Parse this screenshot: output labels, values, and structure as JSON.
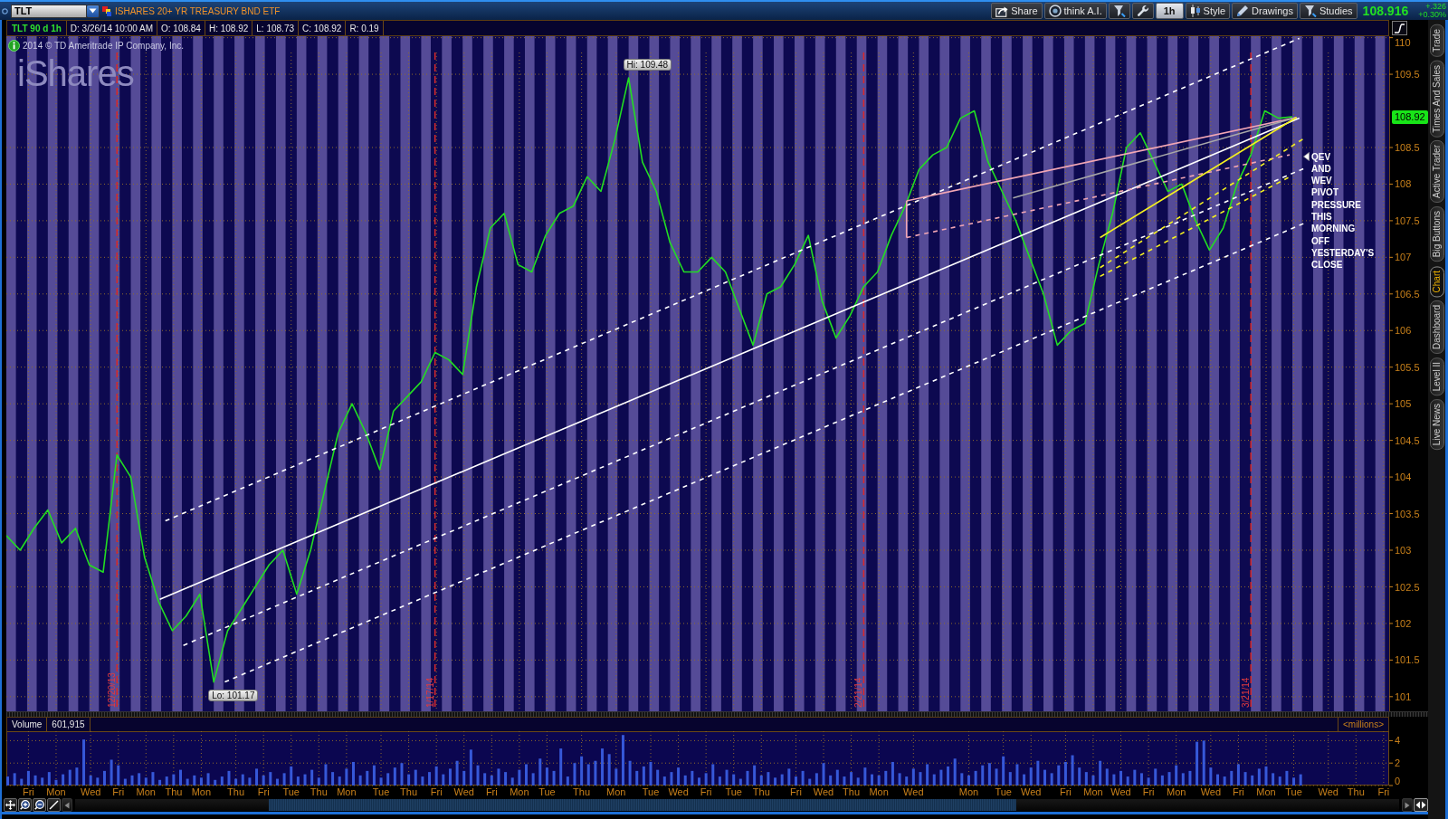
{
  "toolbar": {
    "symbol": "TLT",
    "description": "ISHARES 20+ YR TREASURY BND ETF",
    "buttons": [
      {
        "kind": "share",
        "label": "Share"
      },
      {
        "kind": "assistant",
        "label": "think A.I."
      },
      {
        "kind": "tools"
      },
      {
        "kind": "wrench"
      },
      {
        "kind": "interval",
        "label": "1h"
      },
      {
        "kind": "style",
        "label": "Style"
      },
      {
        "kind": "drawings",
        "label": "Drawings"
      },
      {
        "kind": "studies",
        "label": "Studies"
      }
    ],
    "last_price": "108.916",
    "change": "+.326",
    "change_percent": "+0.30%"
  },
  "info_bar": {
    "study": "TLT 90 d 1h",
    "fields": [
      "D: 3/26/14 10:00 AM",
      "O: 108.84",
      "H: 108.92",
      "L: 108.73",
      "C: 108.92",
      "R: 0.19"
    ]
  },
  "price_chart": {
    "copyright": "2014 © TD Ameritrade IP Company, Inc.",
    "logo_text": "iShares",
    "high_label": "Hi: 109.48",
    "low_label": "Lo: 101.17",
    "current_price": "108.92",
    "note": "QEV AND WEV PIVOT PRESSURE THIS MORNING OFF YESTERDAY'S CLOSE",
    "chart_data": {
      "type": "line",
      "categories": [
        null,
        null,
        null,
        null,
        null,
        null,
        null,
        null,
        "12/20/13",
        null,
        null,
        null,
        null,
        null,
        null,
        null,
        null,
        null,
        null,
        null,
        null,
        null,
        null,
        null,
        null,
        null,
        null,
        null,
        null,
        null,
        null,
        "1/17/14",
        null,
        null,
        null,
        null,
        null,
        null,
        null,
        null,
        null,
        null,
        null,
        null,
        null,
        null,
        null,
        null,
        null,
        null,
        null,
        null,
        null,
        null,
        null,
        null,
        null,
        null,
        null,
        null,
        null,
        null,
        "2/21/14",
        null,
        null,
        null,
        null,
        null,
        null,
        null,
        null,
        null,
        null,
        null,
        null,
        null,
        null,
        null,
        null,
        null,
        null,
        null,
        null,
        null,
        null,
        null,
        null,
        null,
        null,
        null,
        "3/21/14",
        null,
        null,
        null,
        null,
        null,
        null,
        null,
        null,
        null
      ],
      "series": [
        {
          "color": "#22dd22",
          "values": [
            103.2,
            103.0,
            103.3,
            103.55,
            103.1,
            103.3,
            102.8,
            102.7,
            104.3,
            104.0,
            102.9,
            102.3,
            101.9,
            102.1,
            102.4,
            101.2,
            101.9,
            102.2,
            102.5,
            102.8,
            103.0,
            102.4,
            103.0,
            103.8,
            104.6,
            105.0,
            104.6,
            104.1,
            104.9,
            105.1,
            105.3,
            105.7,
            105.6,
            105.4,
            106.6,
            107.4,
            107.6,
            106.9,
            106.8,
            107.3,
            107.6,
            107.7,
            108.1,
            107.9,
            108.6,
            109.45,
            108.3,
            107.9,
            107.2,
            106.8,
            106.8,
            107.0,
            106.8,
            106.3,
            105.8,
            106.5,
            106.6,
            106.9,
            107.3,
            106.4,
            105.9,
            106.2,
            106.6,
            106.8,
            107.3,
            107.7,
            108.2,
            108.4,
            108.5,
            108.9,
            109.0,
            108.3,
            107.9,
            107.5,
            107.0,
            106.5,
            105.8,
            106.0,
            106.1,
            106.9,
            107.6,
            108.5,
            108.7,
            108.3,
            107.9,
            108.0,
            107.5,
            107.1,
            107.4,
            108.0,
            108.4,
            109.0,
            108.9,
            108.92,
            null,
            null,
            null,
            null,
            null,
            null
          ]
        }
      ],
      "ylim": [
        100.8,
        110.02
      ],
      "yticks": [
        101,
        101.5,
        102,
        102.5,
        103,
        103.5,
        104,
        104.5,
        105,
        105.5,
        106,
        106.5,
        107,
        107.5,
        108,
        108.5,
        109.5,
        110
      ],
      "grid": true
    }
  },
  "volume_chart": {
    "title": "Volume",
    "reading": "601,915",
    "units": "<millions>",
    "chart_data": {
      "type": "bar",
      "categories": [
        null,
        null,
        null,
        "Fri",
        null,
        null,
        null,
        "Mon",
        null,
        null,
        null,
        null,
        "Wed",
        null,
        null,
        null,
        "Fri",
        null,
        null,
        null,
        "Mon",
        null,
        null,
        null,
        "Thu",
        null,
        null,
        null,
        "Mon",
        null,
        null,
        null,
        null,
        "Thu",
        null,
        null,
        null,
        "Fri",
        null,
        null,
        null,
        "Tue",
        null,
        null,
        null,
        "Thu",
        null,
        null,
        null,
        "Mon",
        null,
        null,
        null,
        null,
        "Tue",
        null,
        null,
        null,
        "Thu",
        null,
        null,
        null,
        "Fri",
        null,
        null,
        null,
        "Wed",
        null,
        null,
        null,
        "Fri",
        null,
        null,
        null,
        "Mon",
        null,
        null,
        null,
        "Tue",
        null,
        null,
        null,
        null,
        "Thu",
        null,
        null,
        null,
        null,
        "Mon",
        null,
        null,
        null,
        null,
        "Tue",
        null,
        null,
        null,
        "Wed",
        null,
        null,
        null,
        "Fri",
        null,
        null,
        null,
        "Tue",
        null,
        null,
        null,
        "Thu",
        null,
        null,
        null,
        null,
        "Fri",
        null,
        null,
        null,
        "Wed",
        null,
        null,
        null,
        "Thu",
        null,
        null,
        null,
        "Mon",
        null,
        null,
        null,
        null,
        "Wed",
        null,
        null,
        null,
        null,
        null,
        null,
        null,
        "Mon",
        null,
        null,
        null,
        null,
        "Tue",
        null,
        null,
        null,
        "Wed",
        null,
        null,
        null,
        null,
        "Fri",
        null,
        null,
        null,
        "Mon",
        null,
        null,
        null,
        "Wed",
        null,
        null,
        null,
        "Fri",
        null,
        null,
        null,
        "Mon",
        null,
        null,
        null,
        null,
        "Wed",
        null,
        null,
        null,
        "Fri",
        null,
        null,
        null,
        "Mon",
        null,
        null,
        null,
        "Tue",
        null,
        null,
        null,
        null,
        "Wed",
        null,
        null,
        null,
        "Thu",
        null,
        null,
        null,
        "Fri"
      ],
      "series": [
        {
          "color": "#3658d8",
          "values": [
            0.8,
            1.1,
            0.6,
            1.3,
            0.9,
            0.7,
            1.2,
            0.5,
            1.0,
            1.4,
            1.6,
            4.1,
            0.9,
            0.7,
            1.3,
            2.3,
            1.8,
            0.6,
            0.9,
            1.1,
            0.7,
            1.2,
            0.5,
            0.8,
            1.0,
            1.4,
            0.6,
            0.9,
            0.7,
            1.1,
            0.5,
            0.8,
            1.3,
            0.6,
            1.0,
            0.7,
            1.5,
            0.9,
            1.2,
            0.6,
            1.1,
            1.7,
            0.8,
            1.0,
            1.4,
            0.7,
            1.9,
            1.2,
            0.8,
            1.5,
            2.1,
            0.9,
            1.3,
            1.8,
            0.7,
            1.1,
            1.6,
            2.0,
            1.0,
            1.4,
            0.8,
            1.2,
            1.7,
            1.0,
            1.5,
            2.2,
            1.3,
            3.2,
            1.8,
            1.1,
            0.9,
            1.5,
            1.2,
            0.7,
            1.4,
            1.9,
            1.1,
            2.4,
            1.6,
            1.3,
            3.3,
            0.8,
            2.0,
            2.6,
            1.9,
            2.2,
            3.3,
            2.8,
            1.5,
            4.5,
            2.2,
            1.3,
            1.7,
            2.1,
            1.4,
            0.8,
            1.2,
            1.6,
            0.9,
            1.3,
            0.7,
            1.1,
            1.9,
            0.8,
            1.4,
            1.0,
            0.6,
            1.3,
            1.8,
            0.9,
            1.2,
            0.7,
            1.0,
            1.5,
            0.8,
            1.3,
            0.6,
            1.1,
            2.0,
            0.9,
            1.4,
            0.8,
            1.2,
            0.7,
            1.6,
            1.0,
            0.9,
            1.3,
            2.1,
            1.1,
            0.8,
            1.5,
            1.2,
            1.9,
            1.0,
            1.4,
            1.7,
            2.4,
            1.1,
            0.9,
            1.3,
            1.8,
            2.0,
            1.5,
            2.6,
            1.2,
            1.9,
            1.0,
            1.6,
            2.2,
            1.4,
            1.1,
            1.8,
            2.1,
            2.7,
            1.6,
            1.2,
            0.9,
            2.2,
            1.5,
            1.0,
            1.3,
            0.8,
            1.4,
            1.1,
            0.7,
            1.5,
            0.9,
            1.2,
            1.8,
            1.1,
            1.3,
            3.9,
            4.0,
            1.6,
            1.0,
            0.8,
            1.3,
            1.9,
            1.2,
            0.9,
            1.5,
            1.7,
            1.1,
            0.8,
            1.3,
            0.7,
            1.0,
            null,
            null,
            null,
            null,
            null,
            null,
            null,
            null,
            null,
            null,
            null,
            null
          ]
        }
      ],
      "ylim": [
        0,
        4.84
      ],
      "yticks": [
        0,
        2,
        4
      ],
      "grid": true
    }
  },
  "side_tabs": [
    {
      "label": "Trade",
      "selected": false
    },
    {
      "label": "Times And Sales",
      "selected": false
    },
    {
      "label": "Active Trader",
      "selected": false
    },
    {
      "label": "Big Buttons",
      "selected": false
    },
    {
      "label": "Chart",
      "selected": true
    },
    {
      "label": "Dashboard",
      "selected": false
    },
    {
      "label": "Level II",
      "selected": false
    },
    {
      "label": "Live News",
      "selected": false
    }
  ]
}
